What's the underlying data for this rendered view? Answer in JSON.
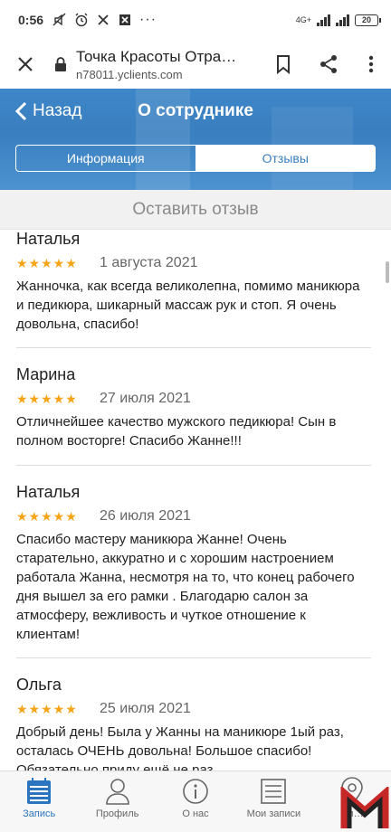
{
  "status_bar": {
    "time": "0:56",
    "network": "4G+",
    "battery": "20"
  },
  "browser": {
    "title": "Точка Красоты Отра…",
    "url": "n78011.yclients.com"
  },
  "header": {
    "back_label": "Назад",
    "title": "О сотруднике",
    "tabs": [
      {
        "label": "Информация",
        "selected": false
      },
      {
        "label": "Отзывы",
        "selected": true
      }
    ]
  },
  "leave_review_label": "Оставить отзыв",
  "reviews": [
    {
      "name": "Наталья",
      "stars": "★★★★★",
      "rating": 5,
      "date": "1 августа 2021",
      "text": "Жанночка, как всегда великолепна, помимо маникюра и педикюра, шикарный массаж рук и стоп. Я очень довольна, спасибо!"
    },
    {
      "name": "Марина",
      "stars": "★★★★★",
      "rating": 5,
      "date": "27 июля 2021",
      "text": "Отличнейшее качество мужского педикюра! Сын в полном восторге! Спасибо Жанне!!!"
    },
    {
      "name": "Наталья",
      "stars": "★★★★★",
      "rating": 5,
      "date": "26 июля 2021",
      "text": "Спасибо мастеру маникюра Жанне! Очень старательно, аккуратно и с хорошим настроением работала Жанна, несмотря на то, что конец рабочего дня вышел за его рамки . Благодарю салон за атмосферу, вежливость и чуткое отношение к клиентам!"
    },
    {
      "name": "Ольга",
      "stars": "★★★★★",
      "rating": 5,
      "date": "25 июля 2021",
      "text": "Добрый день! Была у Жанны на маникюре 1ый раз, осталась ОЧЕНЬ довольна! Большое спасибо! Обязательно приду ещё не раз"
    }
  ],
  "bottom_nav": {
    "items": [
      {
        "label": "Запись",
        "icon": "calendar-icon",
        "active": true
      },
      {
        "label": "Профиль",
        "icon": "person-icon",
        "active": false
      },
      {
        "label": "О нас",
        "icon": "info-icon",
        "active": false
      },
      {
        "label": "Мои записи",
        "icon": "list-icon",
        "active": false
      },
      {
        "label": "Фи…",
        "icon": "location-pin-icon",
        "active": false
      }
    ]
  },
  "colors": {
    "header_blue": "#3a7fc0",
    "star_orange": "#f6a417",
    "nav_active": "#2b75c0"
  }
}
